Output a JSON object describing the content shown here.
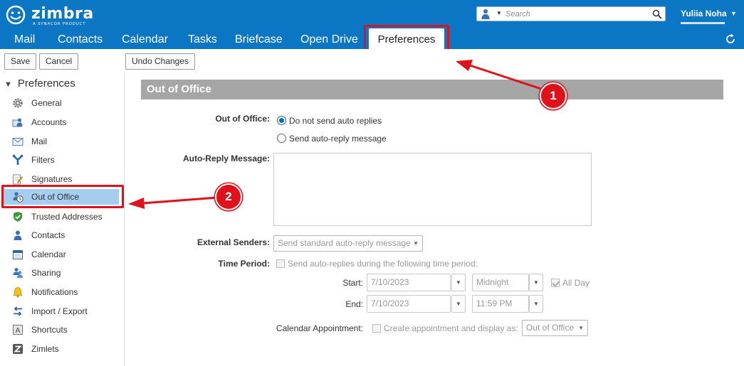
{
  "app": {
    "logo_text": "zimbra",
    "logo_sub": "A SYNACOR PRODUCT",
    "search_placeholder": "Search",
    "user_name": "Yuliia Noha"
  },
  "tabs": [
    "Mail",
    "Contacts",
    "Calendar",
    "Tasks",
    "Briefcase",
    "Open Drive"
  ],
  "active_tab": "Preferences",
  "toolbar": {
    "save_label": "Save",
    "cancel_label": "Cancel",
    "undo_label": "Undo Changes"
  },
  "sidebar": {
    "title": "Preferences",
    "items": [
      {
        "label": "General",
        "icon": "gear-icon"
      },
      {
        "label": "Accounts",
        "icon": "accounts-icon"
      },
      {
        "label": "Mail",
        "icon": "envelope-icon"
      },
      {
        "label": "Filters",
        "icon": "filter-icon"
      },
      {
        "label": "Signatures",
        "icon": "signature-icon"
      },
      {
        "label": "Out of Office",
        "icon": "out-of-office-icon",
        "selected": true
      },
      {
        "label": "Trusted Addresses",
        "icon": "shield-check-icon"
      },
      {
        "label": "Contacts",
        "icon": "contacts-icon"
      },
      {
        "label": "Calendar",
        "icon": "calendar-icon"
      },
      {
        "label": "Sharing",
        "icon": "sharing-icon"
      },
      {
        "label": "Notifications",
        "icon": "bell-icon"
      },
      {
        "label": "Import / Export",
        "icon": "import-export-icon"
      },
      {
        "label": "Shortcuts",
        "icon": "shortcut-icon"
      },
      {
        "label": "Zimlets",
        "icon": "zimlet-icon"
      }
    ]
  },
  "content": {
    "section_title": "Out of Office",
    "out_of_office_label": "Out of Office:",
    "radio_no_reply": "Do not send auto replies",
    "radio_send_reply": "Send auto-reply message",
    "auto_reply_label": "Auto-Reply Message:",
    "auto_reply_value": "",
    "external_senders_label": "External Senders:",
    "external_senders_value": "Send standard auto-reply message",
    "time_period_label": "Time Period:",
    "time_period_checkbox": "Send auto-replies during the following time period:",
    "start_label": "Start:",
    "start_date": "7/10/2023",
    "start_time": "Midnight",
    "all_day_label": "All Day",
    "end_label": "End:",
    "end_date": "7/10/2023",
    "end_time": "11:59 PM",
    "calendar_appt_label": "Calendar Appointment:",
    "calendar_appt_checkbox": "Create appointment and display as:",
    "calendar_appt_value": "Out of Office"
  },
  "annotations": {
    "badge_1": "1",
    "badge_2": "2"
  },
  "colors": {
    "header_blue": "#0b77c4",
    "highlight_red": "#e0111b",
    "selected_item": "#a5cdf0",
    "section_bar": "#a6a6a6"
  }
}
